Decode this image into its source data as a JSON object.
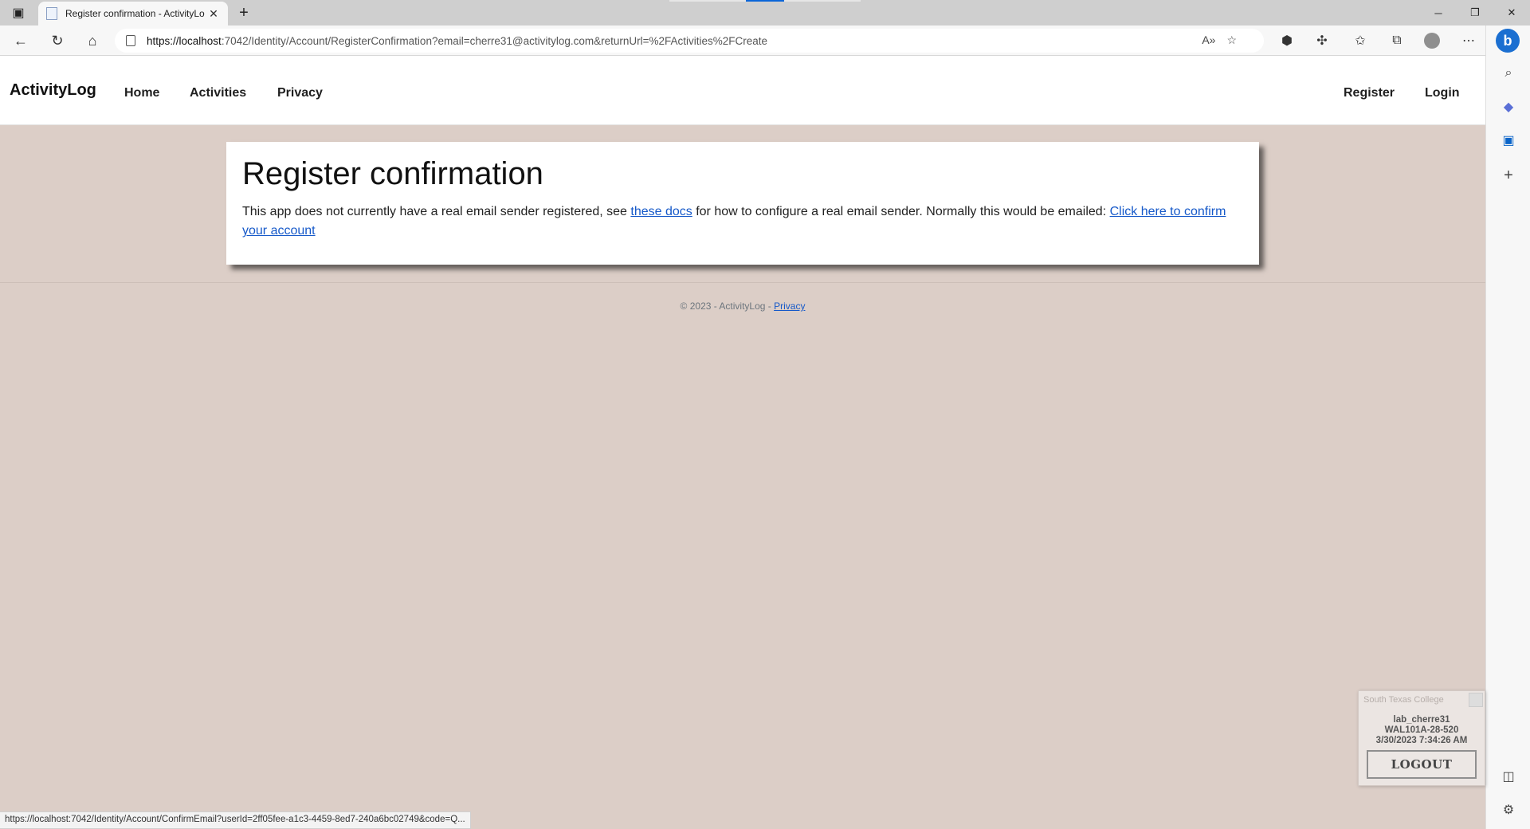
{
  "browser": {
    "tab_title": "Register confirmation - ActivityLo",
    "tab_close": "✕",
    "new_tab": "+",
    "url_host": "https://localhost",
    "url_rest": ":7042/Identity/Account/RegisterConfirmation?email=cherre31@activitylog.com&returnUrl=%2FActivities%2FCreate",
    "status_url": "https://localhost:7042/Identity/Account/ConfirmEmail?userId=2ff05fee-a1c3-4459-8ed7-240a6bc02749&code=Q...",
    "icons": [
      "tab-actions-icon",
      "back-icon",
      "refresh-icon",
      "home-icon",
      "lock-icon",
      "read-aloud-icon",
      "favorite-add-icon",
      "extension-puzzle-icon",
      "extensions-icon",
      "favorites-icon",
      "collections-icon",
      "profile-icon",
      "more-icon",
      "bing-icon",
      "search-icon",
      "copilot-icon",
      "outlook-icon",
      "add-icon",
      "sidebar-toggle-icon",
      "settings-icon"
    ]
  },
  "navbar": {
    "brand": "ActivityLog",
    "links": [
      "Home",
      "Activities",
      "Privacy"
    ],
    "right_links": [
      "Register",
      "Login"
    ]
  },
  "main": {
    "title": "Register confirmation",
    "text_before": "This app does not currently have a real email sender registered, see ",
    "docs_link": "these docs",
    "text_middle": " for how to configure a real email sender. Normally this would be emailed: ",
    "confirm_link": "Click here to confirm your account"
  },
  "footer": {
    "text": "© 2023 - ActivityLog - ",
    "privacy_link": "Privacy"
  },
  "lab_widget": {
    "org": "South Texas College",
    "user": "lab_cherre31",
    "machine": "WAL101A-28-520",
    "timestamp": "3/30/2023 7:34:26 AM",
    "logout_label": "LOGOUT"
  },
  "colors": {
    "page_background": "#dccec7",
    "link": "#1659c9",
    "accent_blue": "#1b6fd1"
  }
}
